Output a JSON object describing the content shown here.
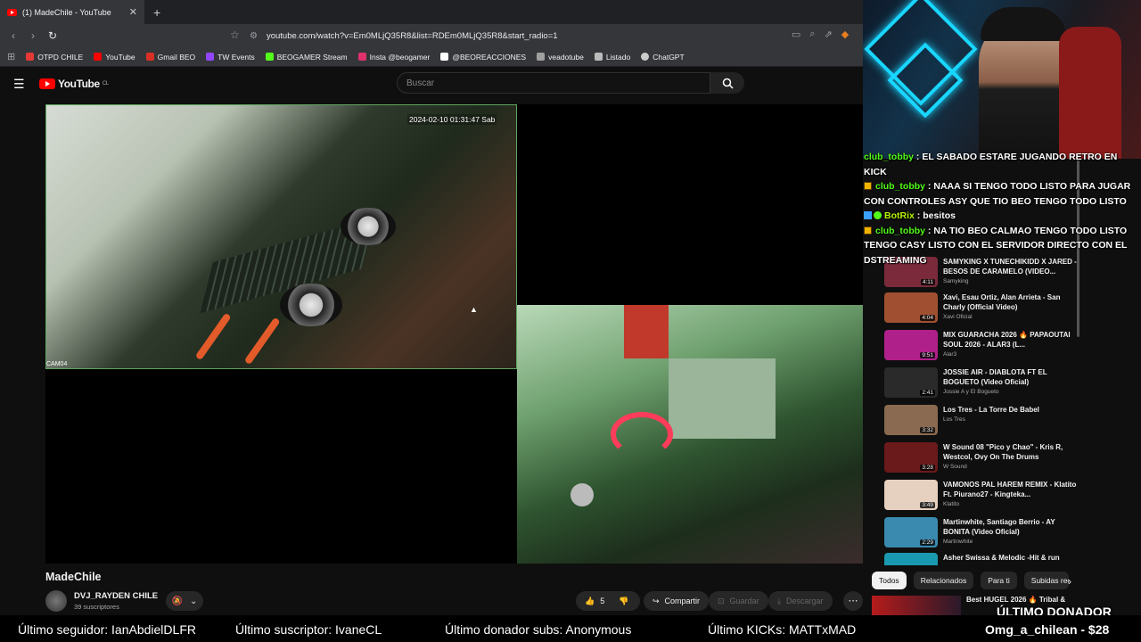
{
  "browser": {
    "tab_title": "(1) MadeChile - YouTube",
    "url": "youtube.com/watch?v=Em0MLjQ35R8&list=RDEm0MLjQ35R8&start_radio=1",
    "bookmarks": [
      {
        "label": "OTPD CHILE",
        "color": "#e53935"
      },
      {
        "label": "YouTube",
        "color": "#ff0000"
      },
      {
        "label": "Gmail BEO",
        "color": "#d93025"
      },
      {
        "label": "TW Events",
        "color": "#9146ff"
      },
      {
        "label": "BEOGAMER Stream",
        "color": "#53fc18"
      },
      {
        "label": "Insta @beogamer",
        "color": "#e1306c"
      },
      {
        "label": "@BEOREACCIONES",
        "color": "#ffffff"
      },
      {
        "label": "veadotube",
        "color": "#a0a0a0"
      },
      {
        "label": "Listado",
        "color": "#bbbbbb"
      },
      {
        "label": "ChatGPT",
        "color": "#cccccc"
      }
    ]
  },
  "youtube": {
    "logo": "YouTube",
    "country": "CL",
    "search_placeholder": "Buscar"
  },
  "video": {
    "timestamp": "2024-02-10 01:31:47 Sab",
    "cam_label": "CAM04",
    "title": "MadeChile",
    "channel": "DVJ_RAYDEN CHILE",
    "subscribers": "39 suscriptores",
    "likes": "5",
    "share": "Compartir",
    "save": "Guardar",
    "download": "Descargar"
  },
  "chat": [
    {
      "user": "club_tobby",
      "text": "EL SABADO ESTARE JUGANDO RETRO EN KICK",
      "user_color": "#53fc18"
    },
    {
      "user": "club_tobby",
      "text": "NAAA SI TENGO TODO LISTO PARA JUGAR CON CONTROLES ASY QUE TIO BEO TENGO TODO LISTO",
      "user_color": "#53fc18"
    },
    {
      "user": "BotRix",
      "text": "besitos",
      "user_color": "#b9f500"
    },
    {
      "user": "club_tobby",
      "text": "NA TIO BEO CALMAO TENGO TODO LISTO TENGO CASY LISTO CON EL SERVIDOR DIRECTO CON EL DSTREAMING",
      "user_color": "#53fc18"
    }
  ],
  "related": [
    {
      "title": "SAMYKING X TUNECHIKIDD X JARED - BESOS DE CARAMELO (VIDEO...",
      "channel": "Samyking",
      "duration": "4:11",
      "color": "#7a2a3a"
    },
    {
      "title": "Xavi, Esau Ortiz, Alan Arrieta - San Charly (Official Video)",
      "channel": "Xavi Oficial",
      "duration": "4:04",
      "color": "#a05030"
    },
    {
      "title": "MIX GUARACHA 2026 🔥 PAPAOUTAI SOUL 2026 - ALAR3 (L...",
      "channel": "Alar3",
      "duration": "9:51",
      "color": "#b0208a"
    },
    {
      "title": "JOSSIE AIR - DIABLOTA FT EL BOGUETO (Video Oficial)",
      "channel": "Jossie A y El Bogueto",
      "duration": "2:41",
      "color": "#2a2a2a"
    },
    {
      "title": "Los Tres - La Torre De Babel",
      "channel": "Los Tres",
      "duration": "3:32",
      "color": "#8a6a50"
    },
    {
      "title": "W Sound 08 \"Pico y Chao\" - Kris R, Westcol, Ovy On The Drums",
      "channel": "W Sound",
      "duration": "3:28",
      "color": "#6a1a1a"
    },
    {
      "title": "VAMONOS PAL HAREM REMIX - Klatito Ft. Piurano27 - Kingteka...",
      "channel": "Klatito",
      "duration": "3:49",
      "color": "#e6d0c0"
    },
    {
      "title": "Martinwhite, Santiago Berrio - AY BONITA (Video Oficial)",
      "channel": "Martinwhite",
      "duration": "2:29",
      "color": "#3a8ab0"
    },
    {
      "title": "Asher Swissa & Melodic -Hit & run",
      "channel": "",
      "duration": "",
      "color": "#1a9ab0"
    }
  ],
  "chips": [
    "Todos",
    "Relacionados",
    "Para ti",
    "Subidas rec"
  ],
  "last_related": {
    "title": "Best HUGEL 2026 🔥 Tribal &"
  },
  "ticker": {
    "follower": "Último seguidor: IanAbdielDLFR",
    "subscriber": "Último suscriptor: IvaneCL",
    "donor_subs": "Último donador subs: Anonymous",
    "kicks": "Último KICKs: MATTxMAD",
    "donor_title": "ÚLTIMO DONADOR",
    "donor": "Omg_a_chilean - $28"
  }
}
